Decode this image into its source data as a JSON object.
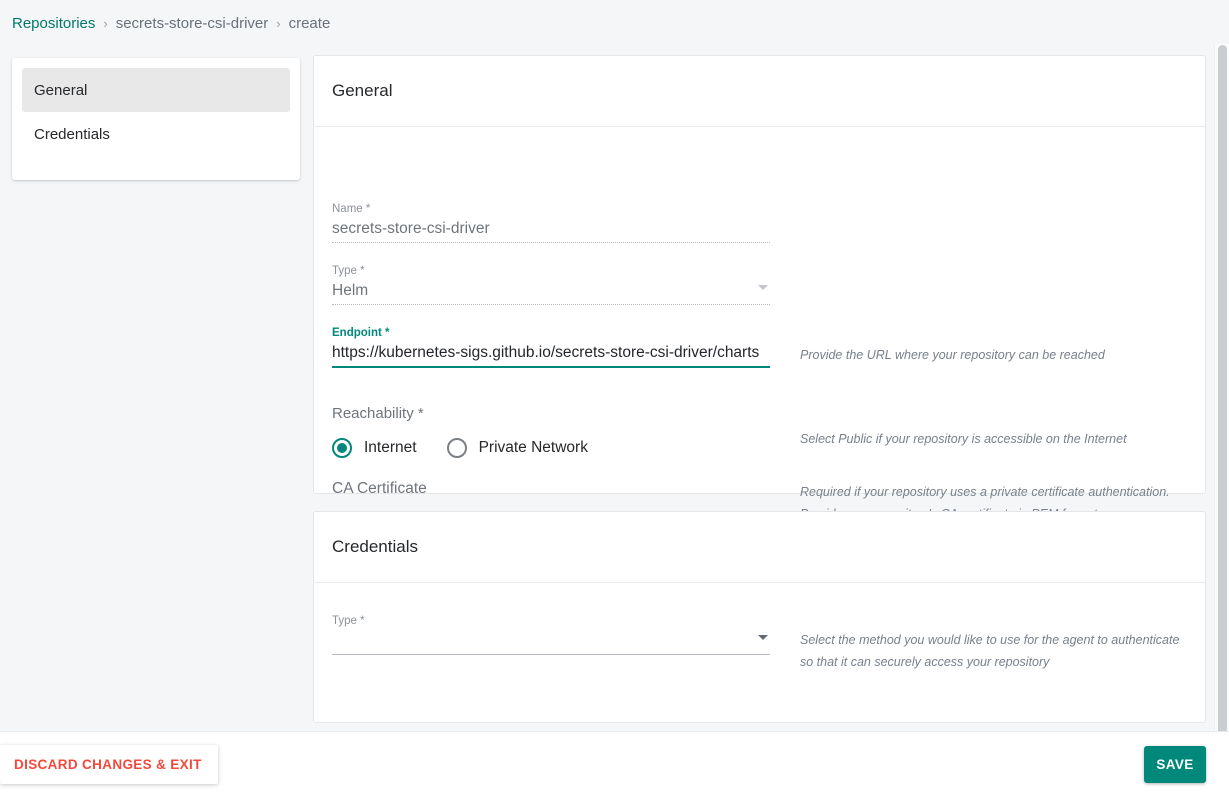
{
  "breadcrumb": {
    "root": "Repositories",
    "separator": "›",
    "repo": "secrets-store-csi-driver",
    "action": "create"
  },
  "sidebar": {
    "items": [
      {
        "label": "General",
        "active": true
      },
      {
        "label": "Credentials",
        "active": false
      }
    ]
  },
  "general": {
    "title": "General",
    "name": {
      "label": "Name",
      "required_mark": " *",
      "value": "secrets-store-csi-driver"
    },
    "type": {
      "label": "Type",
      "required_mark": " *",
      "value": "Helm"
    },
    "endpoint": {
      "label": "Endpoint",
      "required_mark": " *",
      "value": "https://kubernetes-sigs.github.io/secrets-store-csi-driver/charts",
      "hint": "Provide the URL where your repository can be reached"
    },
    "reachability": {
      "label": "Reachability",
      "required_mark": " *",
      "options": [
        {
          "label": "Internet",
          "selected": true
        },
        {
          "label": "Private Network",
          "selected": false
        }
      ],
      "hint": "Select Public if your repository is accessible on the Internet"
    },
    "ca_certificate": {
      "label": "CA Certificate",
      "value": "",
      "hint": "Required if your repository uses a private certificate authentication. Provide your repository's CA certificate in PEM format"
    }
  },
  "credentials": {
    "title": "Credentials",
    "type": {
      "label": "Type",
      "required_mark": " *",
      "value": "",
      "hint": "Select the method you would like to use for the agent to authenticate so that it can securely access your repository"
    }
  },
  "footer": {
    "discard_label": "DISCARD CHANGES & EXIT",
    "save_label": "SAVE"
  },
  "colors": {
    "accent": "#00897b",
    "danger": "#f4483c",
    "page_bg": "#f4f6f8"
  }
}
